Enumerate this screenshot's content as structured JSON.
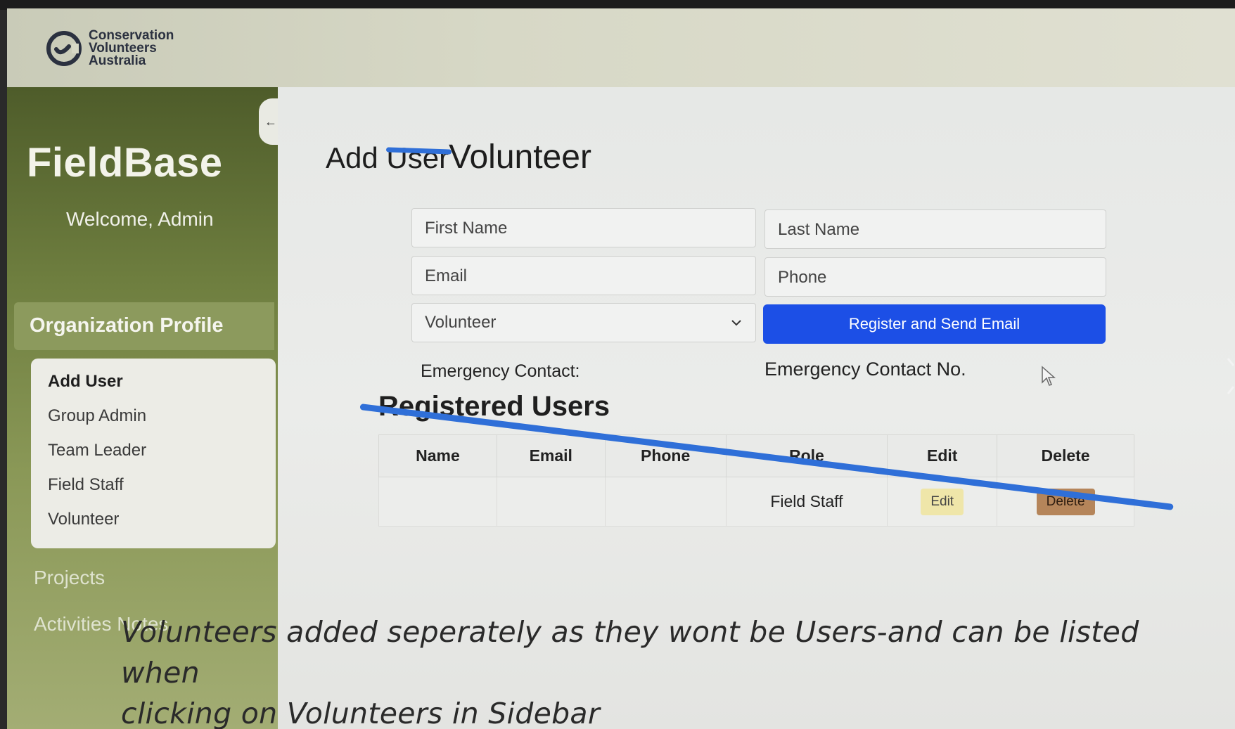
{
  "logo": {
    "line1": "Conservation",
    "line2": "Volunteers",
    "line3": "Australia",
    "icon": "cva-logo-icon"
  },
  "sidebar": {
    "collapse_icon": "←",
    "brand": "FieldBase",
    "welcome": "Welcome, Admin",
    "section": "Organization Profile",
    "items": [
      {
        "label": "Add User",
        "active": true
      },
      {
        "label": "Group Admin"
      },
      {
        "label": "Team Leader"
      },
      {
        "label": "Field Staff"
      },
      {
        "label": "Volunteer"
      }
    ],
    "links": [
      {
        "label": "Projects"
      },
      {
        "label": "Activities Notes"
      }
    ]
  },
  "main": {
    "title_prefix": "Add",
    "title_struck": "User",
    "title_new": "Volunteer",
    "form": {
      "first_name_placeholder": "First Name",
      "last_name_placeholder": "Last Name",
      "email_placeholder": "Email",
      "phone_placeholder": "Phone",
      "role_selected": "Volunteer",
      "register_button": "Register and Send Email",
      "emergency_contact_label": "Emergency Contact:",
      "emergency_contact_no_label": "Emergency Contact No."
    },
    "registered_users": {
      "title": "Registered Users",
      "columns": [
        "Name",
        "Email",
        "Phone",
        "Role",
        "Edit",
        "Delete"
      ],
      "rows": [
        {
          "name": "",
          "email": "",
          "phone": "",
          "role": "Field Staff",
          "edit": "Edit",
          "delete": "Delete"
        }
      ]
    }
  },
  "annotation": {
    "line1": "Volunteers added seperately as they wont be Users-and can be listed when",
    "line2": "clicking on Volunteers in Sidebar"
  },
  "colors": {
    "primary_button": "#1c4fe6",
    "markup_stroke": "#2f6fd8",
    "edit_button": "#efe6a9",
    "delete_button": "#b5855a"
  }
}
